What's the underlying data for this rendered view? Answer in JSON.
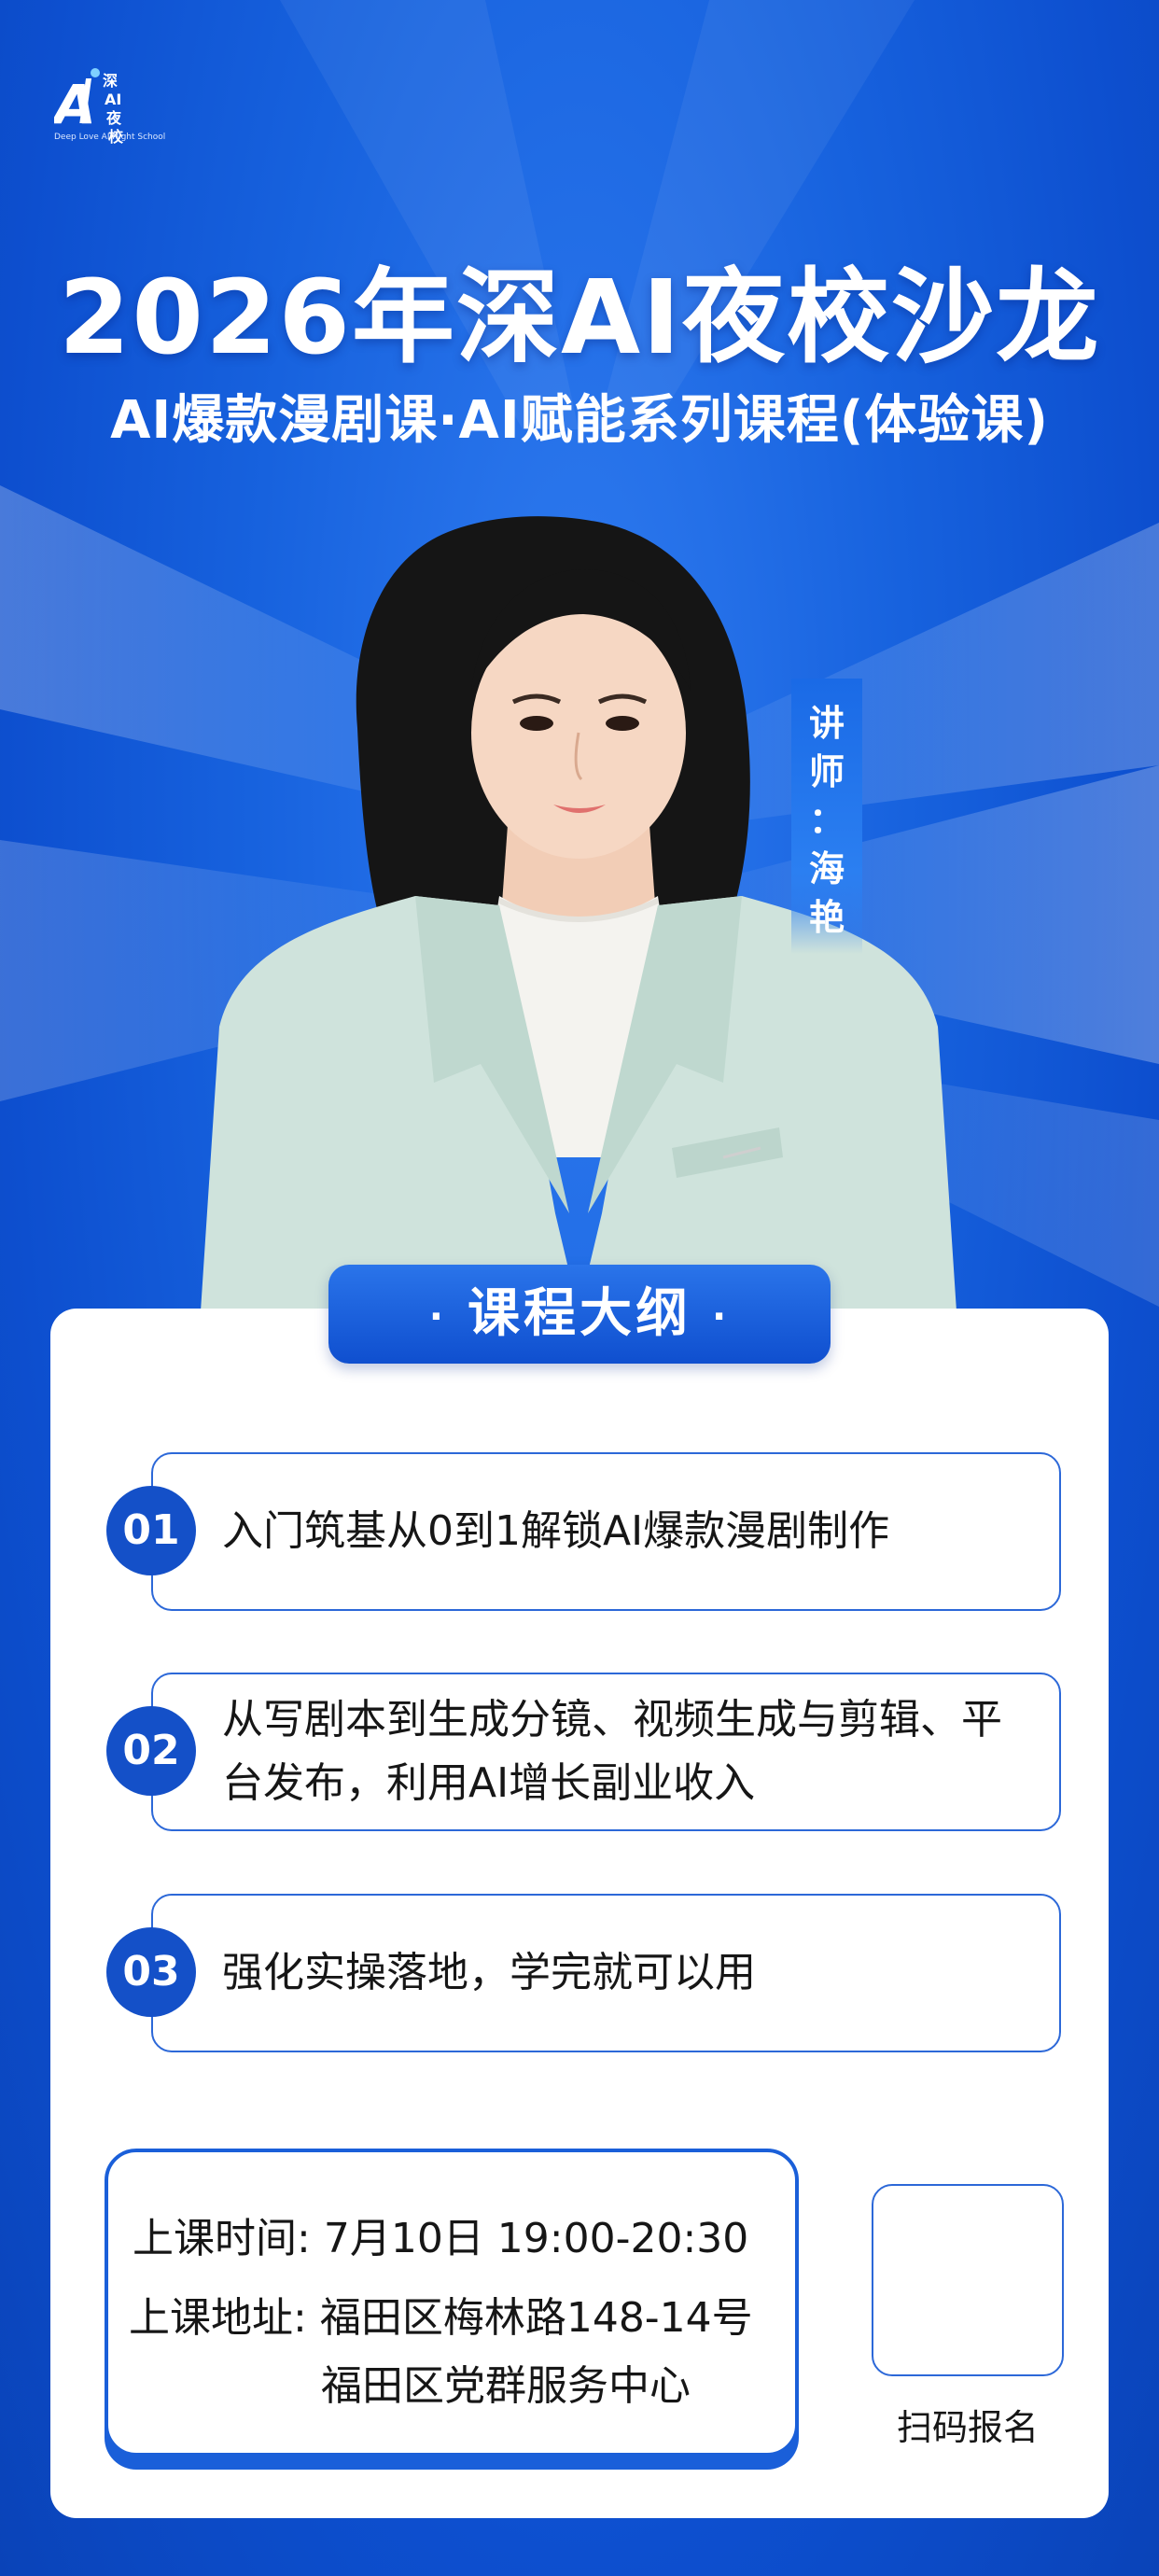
{
  "logo": {
    "mark": "AI",
    "text": "深\nAI\n夜\n校",
    "tagline": "Deep Love AI Night School"
  },
  "header": {
    "title": "2026年深AI夜校沙龙",
    "subtitle": "AI爆款漫剧课·AI赋能系列课程(体验课)"
  },
  "teacher": {
    "label_chars": [
      "讲",
      "师",
      "：",
      "海",
      "艳"
    ]
  },
  "outline": {
    "heading": "课程大纲",
    "dot_left": "·",
    "dot_right": "·",
    "items": [
      {
        "num": "01",
        "text": "入门筑基从0到1解锁AI爆款漫剧制作"
      },
      {
        "num": "02",
        "text": "从写剧本到生成分镜、视频生成与剪辑、平台发布，利用AI增长副业收入"
      },
      {
        "num": "03",
        "text": "强化实操落地，学完就可以用"
      }
    ]
  },
  "info": {
    "time_label": "上课时间:",
    "time_value": "7月10日  19:00-20:30",
    "addr_label": "上课地址:",
    "addr_line1": "福田区梅林路148-14号",
    "addr_line2": "福田区党群服务中心"
  },
  "qr": {
    "label": "扫码报名"
  },
  "colors": {
    "brand_blue": "#1450c8",
    "accent_blue": "#2c68d8",
    "jacket_mint": "#cfe3dc"
  }
}
